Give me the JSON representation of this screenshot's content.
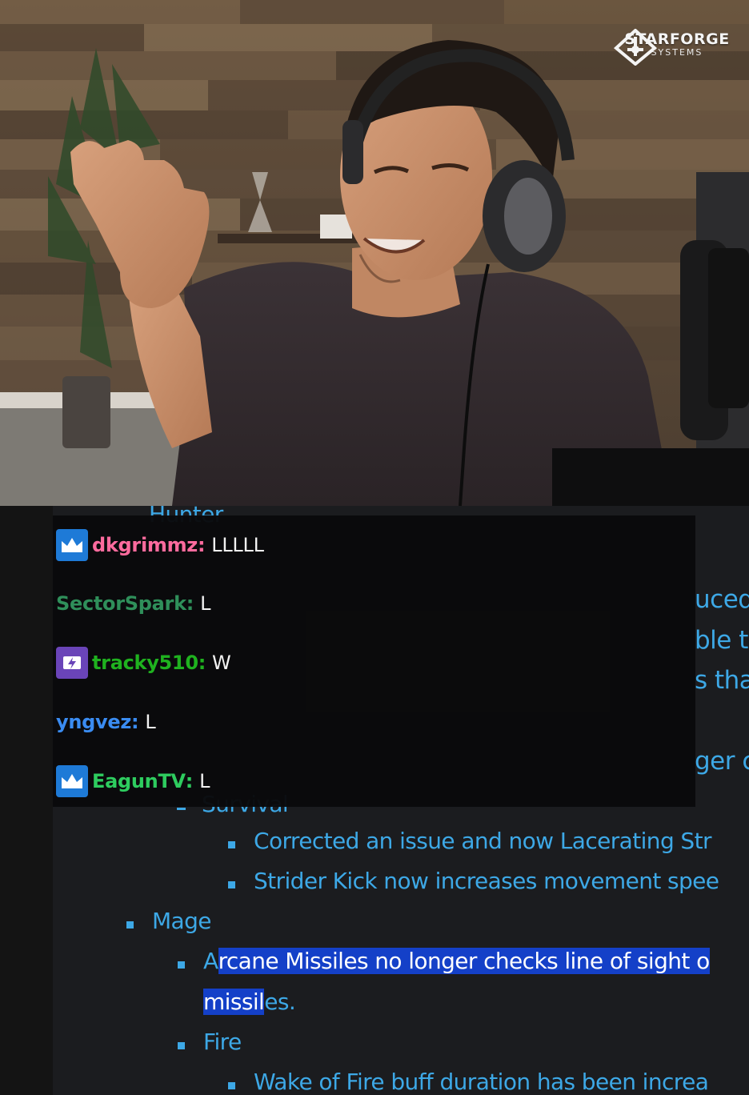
{
  "logo": {
    "name": "STARFORGE",
    "subtitle": "SYSTEMS"
  },
  "chat": {
    "messages": [
      {
        "badge": "crown",
        "username": "dkgrimmz",
        "color": "#ff6b9e",
        "text": "LLLLL"
      },
      {
        "badge": "",
        "username": "SectorSpark",
        "color": "#2f8f5a",
        "text": "L"
      },
      {
        "badge": "turbo",
        "username": "tracky510",
        "color": "#1fb21f",
        "text": "W"
      },
      {
        "badge": "",
        "username": "yngvez",
        "color": "#3a8cf2",
        "text": "L"
      },
      {
        "badge": "crown",
        "username": "EagunTV",
        "color": "#2ecc5f",
        "text": "L"
      }
    ]
  },
  "notes": {
    "partial_top": "Hunter",
    "partial_survival": "Survival",
    "survival_items": [
      "Corrected an issue and now Lacerating Str",
      "Strider Kick now increases movement spee"
    ],
    "mage_heading": "Mage",
    "arcane_lead": "A",
    "arcane_highlight": "rcane Missiles no longer checks line of sight o",
    "arcane_line2_highlight": "missil",
    "arcane_line2_rest": "es.",
    "fire_heading": "Fire",
    "fire_items": [
      "Wake of Fire buff duration has been increa"
    ],
    "peek": [
      "uced",
      "ble t",
      "s tha",
      "ger c"
    ]
  },
  "colors": {
    "link_blue": "#3da8e6",
    "highlight": "#1440c8",
    "chat_bg": "#0a0a0b"
  }
}
